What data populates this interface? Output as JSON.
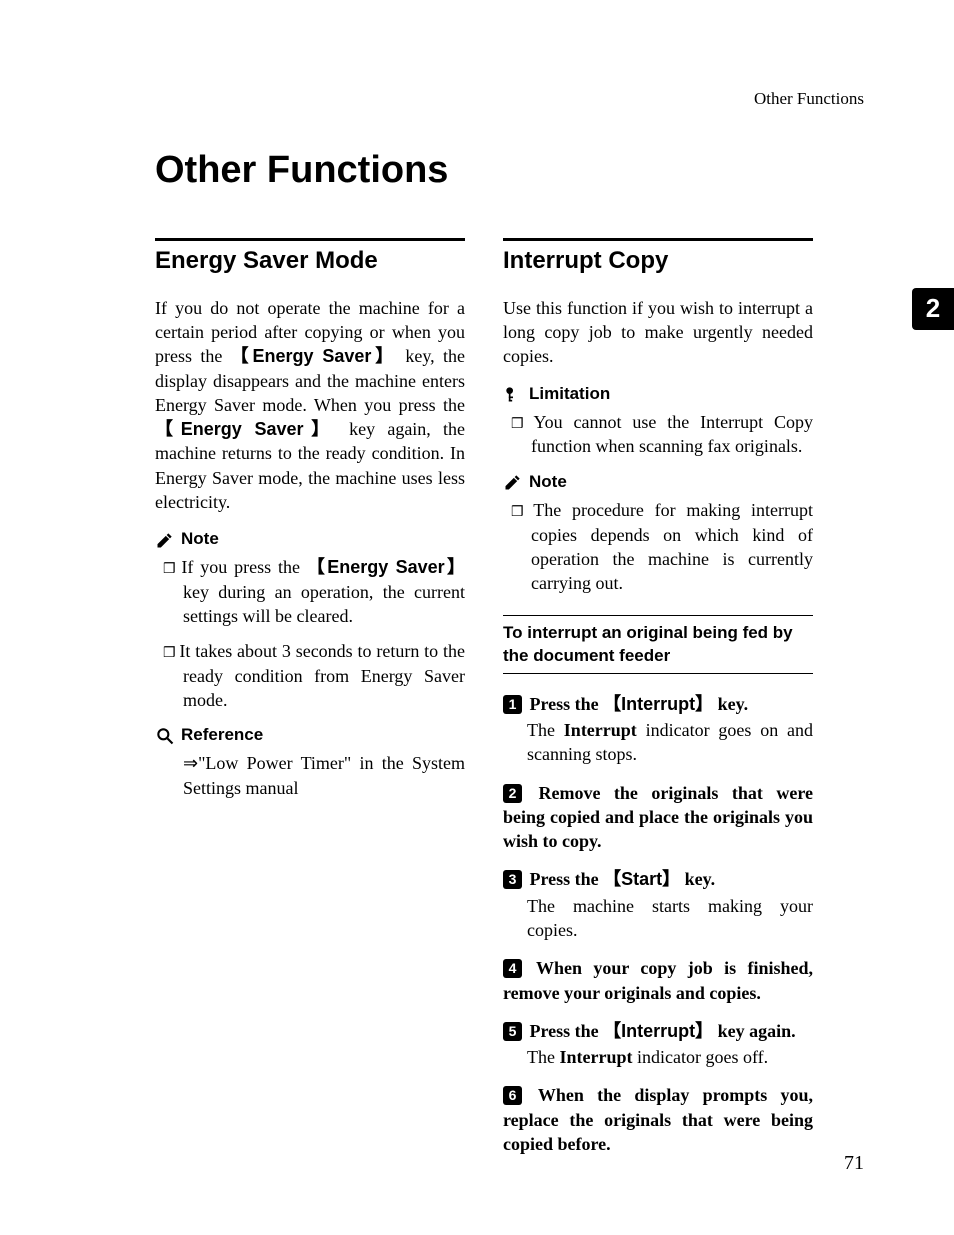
{
  "running_header": "Other Functions",
  "page_title": "Other Functions",
  "chapter_tab": "2",
  "page_number": "71",
  "left": {
    "section_title": "Energy Saver Mode",
    "intro_parts": {
      "p1": "If you do not operate the machine for a certain period after copying or when you press the ",
      "key1": "Energy Saver",
      "p2": " key, the display disappears and the machine enters Energy Saver mode. When you press the ",
      "key2": "Energy Saver",
      "p3": " key again, the machine returns to the ready condition. In Energy Saver mode, the machine uses less electricity."
    },
    "note_label": "Note",
    "notes_item1": {
      "a": "If you press the ",
      "key": "Energy Saver",
      "b": " key during an operation, the current settings will be cleared."
    },
    "notes_item2": "It takes about 3 seconds to return to the ready condition from Energy Saver mode.",
    "reference_label": "Reference",
    "reference_body": "⇒\"Low Power Timer\" in the System Settings manual"
  },
  "right": {
    "section_title": "Interrupt Copy",
    "intro": "Use this function if you wish to interrupt a long copy job to make urgently needed copies.",
    "limitation_label": "Limitation",
    "limitation_body": "You cannot use the Interrupt Copy function when scanning fax originals.",
    "note_label": "Note",
    "note_body": "The procedure for making interrupt copies depends on which kind of operation the machine is currently carrying out.",
    "subsection_title": "To interrupt an original being fed by the document feeder",
    "steps": {
      "s1": {
        "pre": "Press the ",
        "key": "Interrupt",
        "post": " key.",
        "body_pre": "The ",
        "body_bold": "Interrupt",
        "body_post": " indicator goes on and scanning stops."
      },
      "s2": {
        "text": "Remove the originals that were being copied and place the originals you wish to copy."
      },
      "s3": {
        "pre": "Press the ",
        "key": "Start",
        "post": " key.",
        "body": "The machine starts making your copies."
      },
      "s4": {
        "text": "When your copy job is finished, remove your originals and copies."
      },
      "s5": {
        "pre": "Press the ",
        "key": "Interrupt",
        "post": " key again.",
        "body_pre": "The ",
        "body_bold": "Interrupt",
        "body_post": " indicator goes off."
      },
      "s6": {
        "text": "When the display prompts you, replace the originals that were being copied before."
      }
    }
  }
}
